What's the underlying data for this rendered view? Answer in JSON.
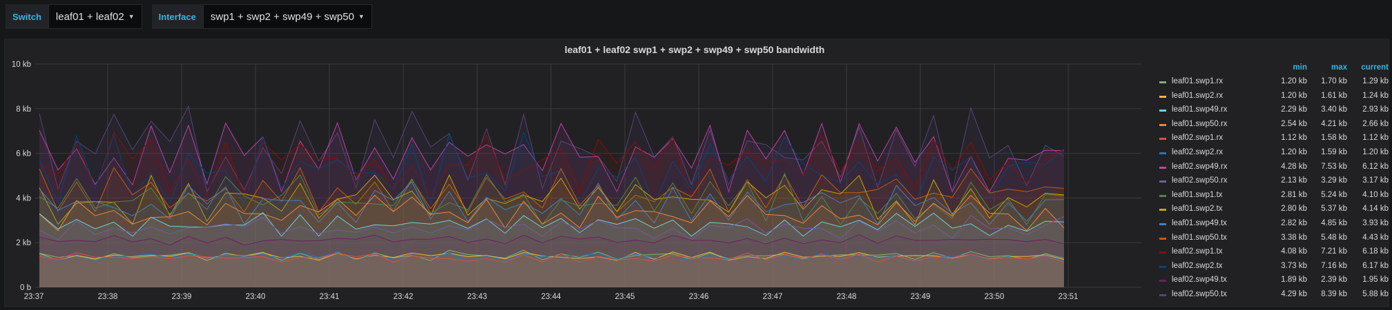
{
  "toolbar": {
    "switch": {
      "label": "Switch",
      "value": "leaf01 + leaf02"
    },
    "interface": {
      "label": "Interface",
      "value": "swp1 + swp2 + swp49 + swp50"
    }
  },
  "panel": {
    "title": "leaf01 + leaf02 swp1 + swp2 + swp49 + swp50 bandwidth"
  },
  "legend": {
    "headers": {
      "min": "min",
      "max": "max",
      "current": "current"
    }
  },
  "chart_data": {
    "type": "area",
    "title": "leaf01 + leaf02 swp1 + swp2 + swp49 + swp50 bandwidth",
    "y_ticks": [
      "10 kb",
      "8 kb",
      "6 kb",
      "4 kb",
      "2 kb",
      "0 b"
    ],
    "x_ticks": [
      "23:37",
      "23:38",
      "23:39",
      "23:40",
      "23:41",
      "23:42",
      "23:43",
      "23:44",
      "23:45",
      "23:46",
      "23:47",
      "23:48",
      "23:49",
      "23:50",
      "23:51"
    ],
    "ylim": [
      0,
      10
    ],
    "y_unit": "kb",
    "grid": true,
    "legend_position": "right",
    "series": [
      {
        "name": "leaf01.swp1.rx",
        "color": "#7eb26d",
        "min": "1.20 kb",
        "max": "1.70 kb",
        "current": "1.29 kb",
        "min_v": 1.2,
        "max_v": 1.7,
        "cur_v": 1.29
      },
      {
        "name": "leaf01.swp2.rx",
        "color": "#eab839",
        "min": "1.20 kb",
        "max": "1.61 kb",
        "current": "1.24 kb",
        "min_v": 1.2,
        "max_v": 1.61,
        "cur_v": 1.24
      },
      {
        "name": "leaf01.swp49.rx",
        "color": "#6ed0e0",
        "min": "2.29 kb",
        "max": "3.40 kb",
        "current": "2.93 kb",
        "min_v": 2.29,
        "max_v": 3.4,
        "cur_v": 2.93
      },
      {
        "name": "leaf01.swp50.rx",
        "color": "#ef843c",
        "min": "2.54 kb",
        "max": "4.21 kb",
        "current": "2.66 kb",
        "min_v": 2.54,
        "max_v": 4.21,
        "cur_v": 2.66
      },
      {
        "name": "leaf02.swp1.rx",
        "color": "#e24d42",
        "min": "1.12 kb",
        "max": "1.58 kb",
        "current": "1.12 kb",
        "min_v": 1.12,
        "max_v": 1.58,
        "cur_v": 1.12
      },
      {
        "name": "leaf02.swp2.rx",
        "color": "#1f78c1",
        "min": "1.20 kb",
        "max": "1.59 kb",
        "current": "1.20 kb",
        "min_v": 1.2,
        "max_v": 1.59,
        "cur_v": 1.2
      },
      {
        "name": "leaf02.swp49.rx",
        "color": "#ba43a9",
        "min": "4.28 kb",
        "max": "7.53 kb",
        "current": "6.12 kb",
        "min_v": 4.28,
        "max_v": 7.53,
        "cur_v": 6.12
      },
      {
        "name": "leaf02.swp50.rx",
        "color": "#705da0",
        "min": "2.13 kb",
        "max": "3.29 kb",
        "current": "3.17 kb",
        "min_v": 2.13,
        "max_v": 3.29,
        "cur_v": 3.17
      },
      {
        "name": "leaf01.swp1.tx",
        "color": "#508642",
        "min": "2.81 kb",
        "max": "5.24 kb",
        "current": "4.10 kb",
        "min_v": 2.81,
        "max_v": 5.24,
        "cur_v": 4.1
      },
      {
        "name": "leaf01.swp2.tx",
        "color": "#cca300",
        "min": "2.80 kb",
        "max": "5.37 kb",
        "current": "4.14 kb",
        "min_v": 2.8,
        "max_v": 5.37,
        "cur_v": 4.14
      },
      {
        "name": "leaf01.swp49.tx",
        "color": "#447ebc",
        "min": "2.82 kb",
        "max": "4.85 kb",
        "current": "3.93 kb",
        "min_v": 2.82,
        "max_v": 4.85,
        "cur_v": 3.93
      },
      {
        "name": "leaf01.swp50.tx",
        "color": "#c15c17",
        "min": "3.38 kb",
        "max": "5.48 kb",
        "current": "4.43 kb",
        "min_v": 3.38,
        "max_v": 5.48,
        "cur_v": 4.43
      },
      {
        "name": "leaf02.swp1.tx",
        "color": "#890f02",
        "min": "4.08 kb",
        "max": "7.21 kb",
        "current": "6.18 kb",
        "min_v": 4.08,
        "max_v": 7.21,
        "cur_v": 6.18
      },
      {
        "name": "leaf02.swp2.tx",
        "color": "#0a437c",
        "min": "3.73 kb",
        "max": "7.16 kb",
        "current": "6.17 kb",
        "min_v": 3.73,
        "max_v": 7.16,
        "cur_v": 6.17
      },
      {
        "name": "leaf02.swp49.tx",
        "color": "#6d1f62",
        "min": "1.89 kb",
        "max": "2.39 kb",
        "current": "1.95 kb",
        "min_v": 1.89,
        "max_v": 2.39,
        "cur_v": 1.95
      },
      {
        "name": "leaf02.swp50.tx",
        "color": "#584477",
        "min": "4.29 kb",
        "max": "8.39 kb",
        "current": "5.88 kb",
        "min_v": 4.29,
        "max_v": 8.39,
        "cur_v": 5.88
      }
    ]
  }
}
